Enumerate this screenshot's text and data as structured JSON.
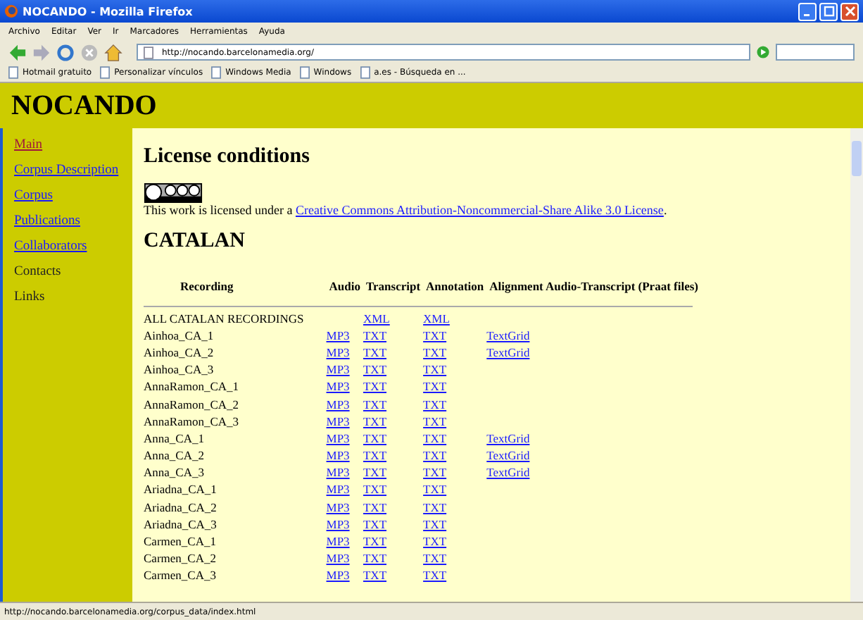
{
  "window": {
    "title": "NOCANDO - Mozilla Firefox"
  },
  "menu": [
    "Archivo",
    "Editar",
    "Ver",
    "Ir",
    "Marcadores",
    "Herramientas",
    "Ayuda"
  ],
  "address": "http://nocando.barcelonamedia.org/",
  "bookmarks": [
    "Hotmail gratuito",
    "Personalizar vínculos",
    "Windows Media",
    "Windows",
    "a.es - Búsqueda en ..."
  ],
  "site_title": "NOCANDO",
  "sidebar": {
    "items": [
      {
        "label": "Main",
        "kind": "link",
        "visited": true
      },
      {
        "label": "Corpus Description",
        "kind": "link",
        "visited": false
      },
      {
        "label": "Corpus",
        "kind": "link",
        "visited": false
      },
      {
        "label": "Publications",
        "kind": "link",
        "visited": false
      },
      {
        "label": "Collaborators",
        "kind": "link",
        "visited": false
      },
      {
        "label": "Contacts",
        "kind": "text"
      },
      {
        "label": "Links",
        "kind": "text"
      }
    ]
  },
  "heading": "License conditions",
  "license_text": "This work is licensed under a ",
  "license_link": "Creative Commons Attribution-Noncommercial-Share Alike 3.0 License",
  "license_end": ".",
  "section": "CATALAN",
  "table": {
    "columns": [
      "Recording",
      "Audio",
      "Transcript",
      "Annotation",
      "Alignment Audio-Transcript (Praat files)"
    ],
    "rows": [
      {
        "name": "ALL CATALAN RECORDINGS",
        "transcript": "XML",
        "annotation": "XML"
      },
      {
        "name": "Ainhoa_CA_1",
        "audio": "MP3",
        "transcript": "TXT",
        "annotation": "TXT",
        "alignment": "TextGrid"
      },
      {
        "name": "Ainhoa_CA_2",
        "audio": "MP3",
        "transcript": "TXT",
        "annotation": "TXT",
        "alignment": "TextGrid"
      },
      {
        "name": "Ainhoa_CA_3",
        "audio": "MP3",
        "transcript": "TXT",
        "annotation": "TXT"
      },
      {
        "name": "AnnaRamon_CA_1",
        "audio": "MP3",
        "transcript": "TXT",
        "annotation": "TXT"
      },
      {
        "name": "AnnaRamon_CA_2",
        "audio": "MP3",
        "transcript": "TXT",
        "annotation": "TXT"
      },
      {
        "name": "AnnaRamon_CA_3",
        "audio": "MP3",
        "transcript": "TXT",
        "annotation": "TXT"
      },
      {
        "name": "Anna_CA_1",
        "audio": "MP3",
        "transcript": "TXT",
        "annotation": "TXT",
        "alignment": "TextGrid"
      },
      {
        "name": "Anna_CA_2",
        "audio": "MP3",
        "transcript": "TXT",
        "annotation": "TXT",
        "alignment": "TextGrid"
      },
      {
        "name": "Anna_CA_3",
        "audio": "MP3",
        "transcript": "TXT",
        "annotation": "TXT",
        "alignment": "TextGrid"
      },
      {
        "name": "Ariadna_CA_1",
        "audio": "MP3",
        "transcript": "TXT",
        "annotation": "TXT"
      },
      {
        "name": "Ariadna_CA_2",
        "audio": "MP3",
        "transcript": "TXT",
        "annotation": "TXT"
      },
      {
        "name": "Ariadna_CA_3",
        "audio": "MP3",
        "transcript": "TXT",
        "annotation": "TXT"
      },
      {
        "name": "Carmen_CA_1",
        "audio": "MP3",
        "transcript": "TXT",
        "annotation": "TXT"
      },
      {
        "name": "Carmen_CA_2",
        "audio": "MP3",
        "transcript": "TXT",
        "annotation": "TXT"
      },
      {
        "name": "Carmen_CA_3",
        "audio": "MP3",
        "transcript": "TXT",
        "annotation": "TXT"
      }
    ]
  },
  "status_bar": "http://nocando.barcelonamedia.org/corpus_data/index.html"
}
